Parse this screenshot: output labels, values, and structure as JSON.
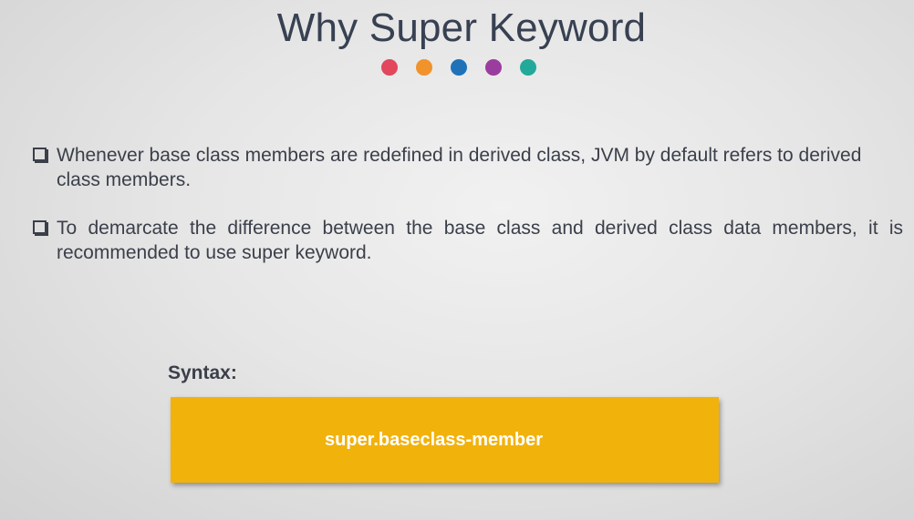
{
  "slide": {
    "title": "Why Super Keyword",
    "decor_dots": [
      "#e2475d",
      "#f0932b",
      "#1f72b8",
      "#9b3d9e",
      "#23a99a"
    ],
    "bullets": [
      "Whenever base class members are redefined in derived class, JVM by default refers to derived class members.",
      "To demarcate the difference between the base class and derived class data members, it is recommended to use super keyword."
    ],
    "syntax_label": "Syntax:",
    "syntax_code": "super.baseclass-member"
  }
}
